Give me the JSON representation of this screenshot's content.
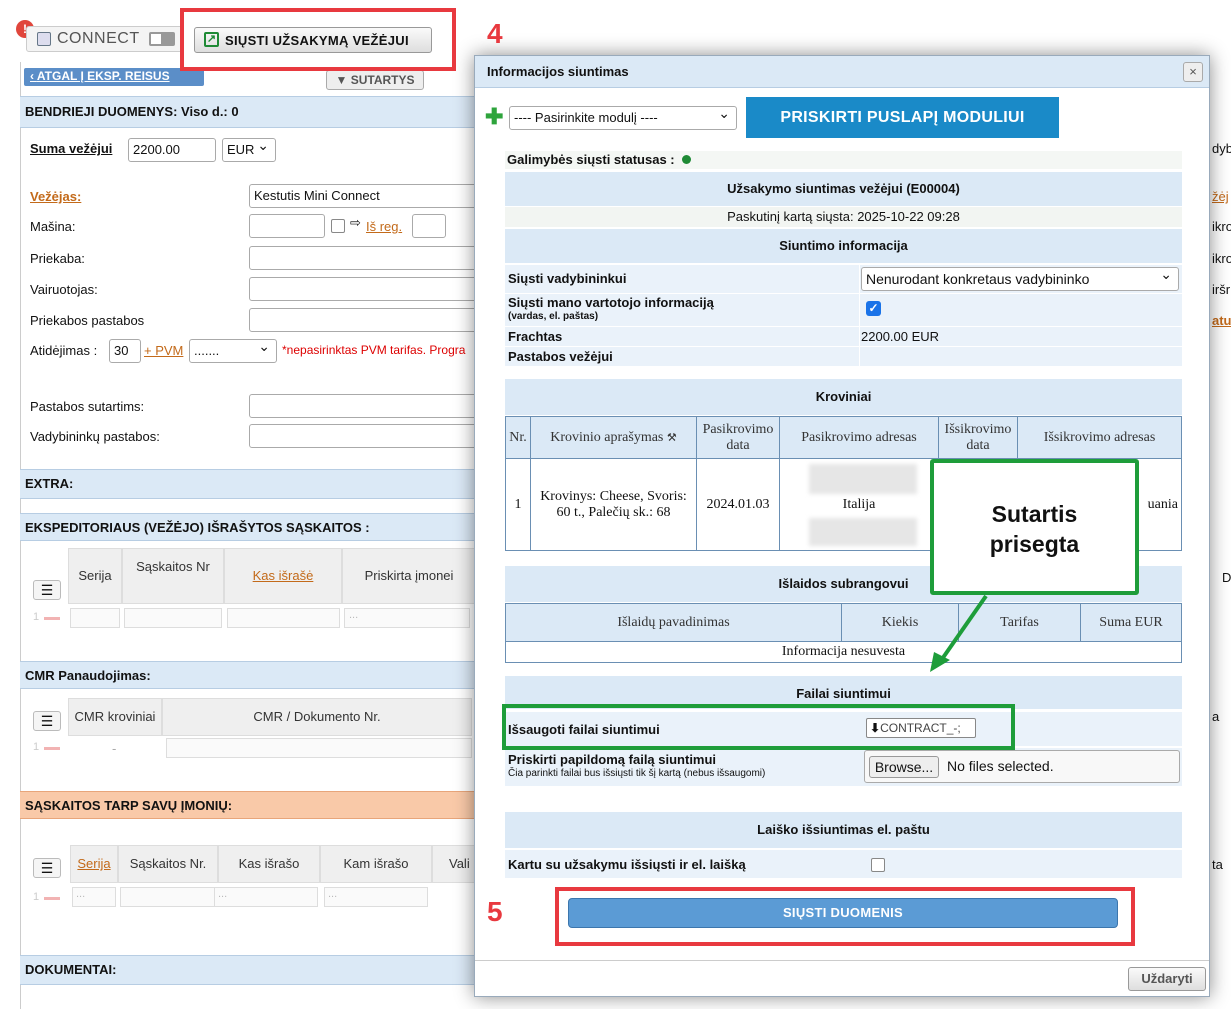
{
  "toolbar": {
    "connect_label": "CONNECT",
    "send_button": "SIŲSTI UŽSAKYMĄ VEŽĖJUI"
  },
  "nav": {
    "back": "ATGAL Į EKSP. REISUS",
    "contracts": "SUTARTYS"
  },
  "left": {
    "general_title": "BENDRIEJI DUOMENYS:",
    "days_label": "Viso d.:",
    "days_value": "0",
    "sum_label": "Suma vežėjui",
    "sum_value": "2200.00",
    "currency": "EUR",
    "carrier_label": "Vežėjas:",
    "carrier_value": "Kestutis Mini Connect",
    "car_label": "Mašina:",
    "from_reg": "Iš reg.",
    "trailer_label": "Priekaba:",
    "driver_label": "Vairuotojas:",
    "trailer_notes_label": "Priekabos pastabos",
    "delay_label": "Atidėjimas :",
    "delay_value": "30",
    "vat_link": "+ PVM",
    "vat_select": ".......",
    "vat_warning": "*nepasirinktas PVM tarifas. Progra",
    "contract_notes_label": "Pastabos sutartims:",
    "manager_notes_label": "Vadybininkų pastabos:",
    "extra_title": "EXTRA:",
    "invoices_title": "EKSPEDITORIAUS (VEŽĖJO) IŠRAŠYTOS SĄSKAITOS :",
    "inv_cols": [
      "Serija",
      "Sąskaitos Nr",
      "Kas išrašė",
      "Priskirta įmonei"
    ],
    "cmr_title": "CMR Panaudojimas:",
    "cmr_cols": [
      "CMR kroviniai",
      "CMR / Dokumento Nr."
    ],
    "cmr_dash": "-",
    "own_inv_title": "SĄSKAITOS TARP SAVŲ ĮMONIŲ:",
    "own_cols": [
      "Serija",
      "Sąskaitos Nr.",
      "Kas išrašo",
      "Kam išrašo",
      "Vali"
    ],
    "docs_title": "DOKUMENTAI:",
    "row_num": "1",
    "ellipsis": "..."
  },
  "right_edge": {
    "r1": "dyb",
    "r2": "žėj",
    "r3": "ikro",
    "r4": "ikrov",
    "r5": "iršr",
    "r6": "atu",
    "r7": "D",
    "r8": "a",
    "r9": "ta"
  },
  "modal": {
    "title": "Informacijos siuntimas",
    "close": "×",
    "module_select": "---- Pasirinkite modulį ----",
    "assign_button": "PRISKIRTI PUSLAPĮ MODULIUI",
    "status_label": "Galimybės siųsti statusas :",
    "send_title": "Užsakymo siuntimas vežėjui (E00004)",
    "last_sent": "Paskutinį kartą siųsta: 2025-10-22 09:28",
    "sending_info": "Siuntimo informacija",
    "send_to_managers_label": "Siųsti vadybininkui",
    "send_to_managers_value": "Nenurodant konkretaus vadybininko",
    "send_my_info_label": "Siųsti mano vartotojo informaciją",
    "send_my_info_sub": "(vardas, el. paštas)",
    "freight_label": "Frachtas",
    "freight_value": "2200.00 EUR",
    "notes_label": "Pastabos vežėjui",
    "cargo_title": "Kroviniai",
    "cargo_cols": [
      "Nr.",
      "Krovinio aprašymas",
      "Pasikrovimo data",
      "Pasikrovimo adresas",
      "Išsikrovimo data",
      "Išsikrovimo adresas"
    ],
    "cargo_row": {
      "nr": "1",
      "desc": "Krovinys: Cheese, Svoris: 60 t., Palečių sk.: 68",
      "load_date": "2024.01.03",
      "load_addr_visible": "Italija",
      "unload_addr_visible": "uania"
    },
    "subcontract_title": "Išlaidos subrangovui",
    "sub_cols": [
      "Išlaidų pavadinimas",
      "Kiekis",
      "Tarifas",
      "Suma EUR"
    ],
    "sub_empty": "Informacija nesuvesta",
    "files_title": "Failai siuntimui",
    "saved_files_label": "Išsaugoti failai siuntimui",
    "saved_file": "CONTRACT_-;",
    "extra_file_label": "Priskirti papildomą failą siuntimui",
    "extra_file_sub": "Čia parinkti failai bus išsiųsti tik šį kartą (nebus išsaugomi)",
    "browse": "Browse...",
    "no_files": "No files selected.",
    "email_title": "Laiško išsiuntimas el. paštu",
    "email_label": "Kartu su užsakymu išsiųsti ir el. laišką",
    "submit": "SIŲSTI DUOMENIS",
    "footer_close": "Uždaryti"
  },
  "annotations": {
    "step4": "4",
    "step5": "5",
    "callout": "Sutartis prisegta"
  },
  "colors": {
    "accent_blue": "#1a8ac8",
    "section_bg": "#dbe9f6",
    "annotation_red": "#e8393f",
    "annotation_green": "#1e9d3a"
  }
}
